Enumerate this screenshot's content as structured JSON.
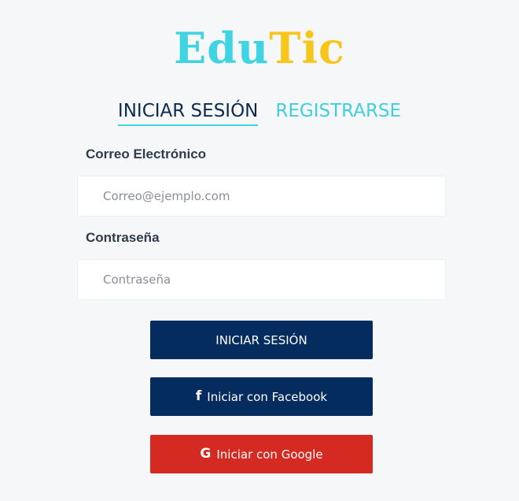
{
  "logo": {
    "part1": "Edu",
    "part2": "Tic"
  },
  "tabs": [
    {
      "label": "INICIAR SESIÓN",
      "active": true
    },
    {
      "label": "REGISTRARSE",
      "active": false
    }
  ],
  "form": {
    "email_label": "Correo Electrónico",
    "email_placeholder": "Correo@ejemplo.com",
    "password_label": "Contraseña",
    "password_placeholder": "Contraseña"
  },
  "buttons": {
    "login_label": "INICIAR SESIÓN",
    "facebook_label": "Iniciar con Facebook",
    "google_label": "Iniciar con Google"
  },
  "icons": {
    "facebook": "facebook-icon",
    "google": "google-icon"
  },
  "colors": {
    "brand_cyan": "#3fd3e3",
    "brand_yellow": "#f8c51a",
    "navy": "#052c5e",
    "google_red": "#d52a22"
  }
}
